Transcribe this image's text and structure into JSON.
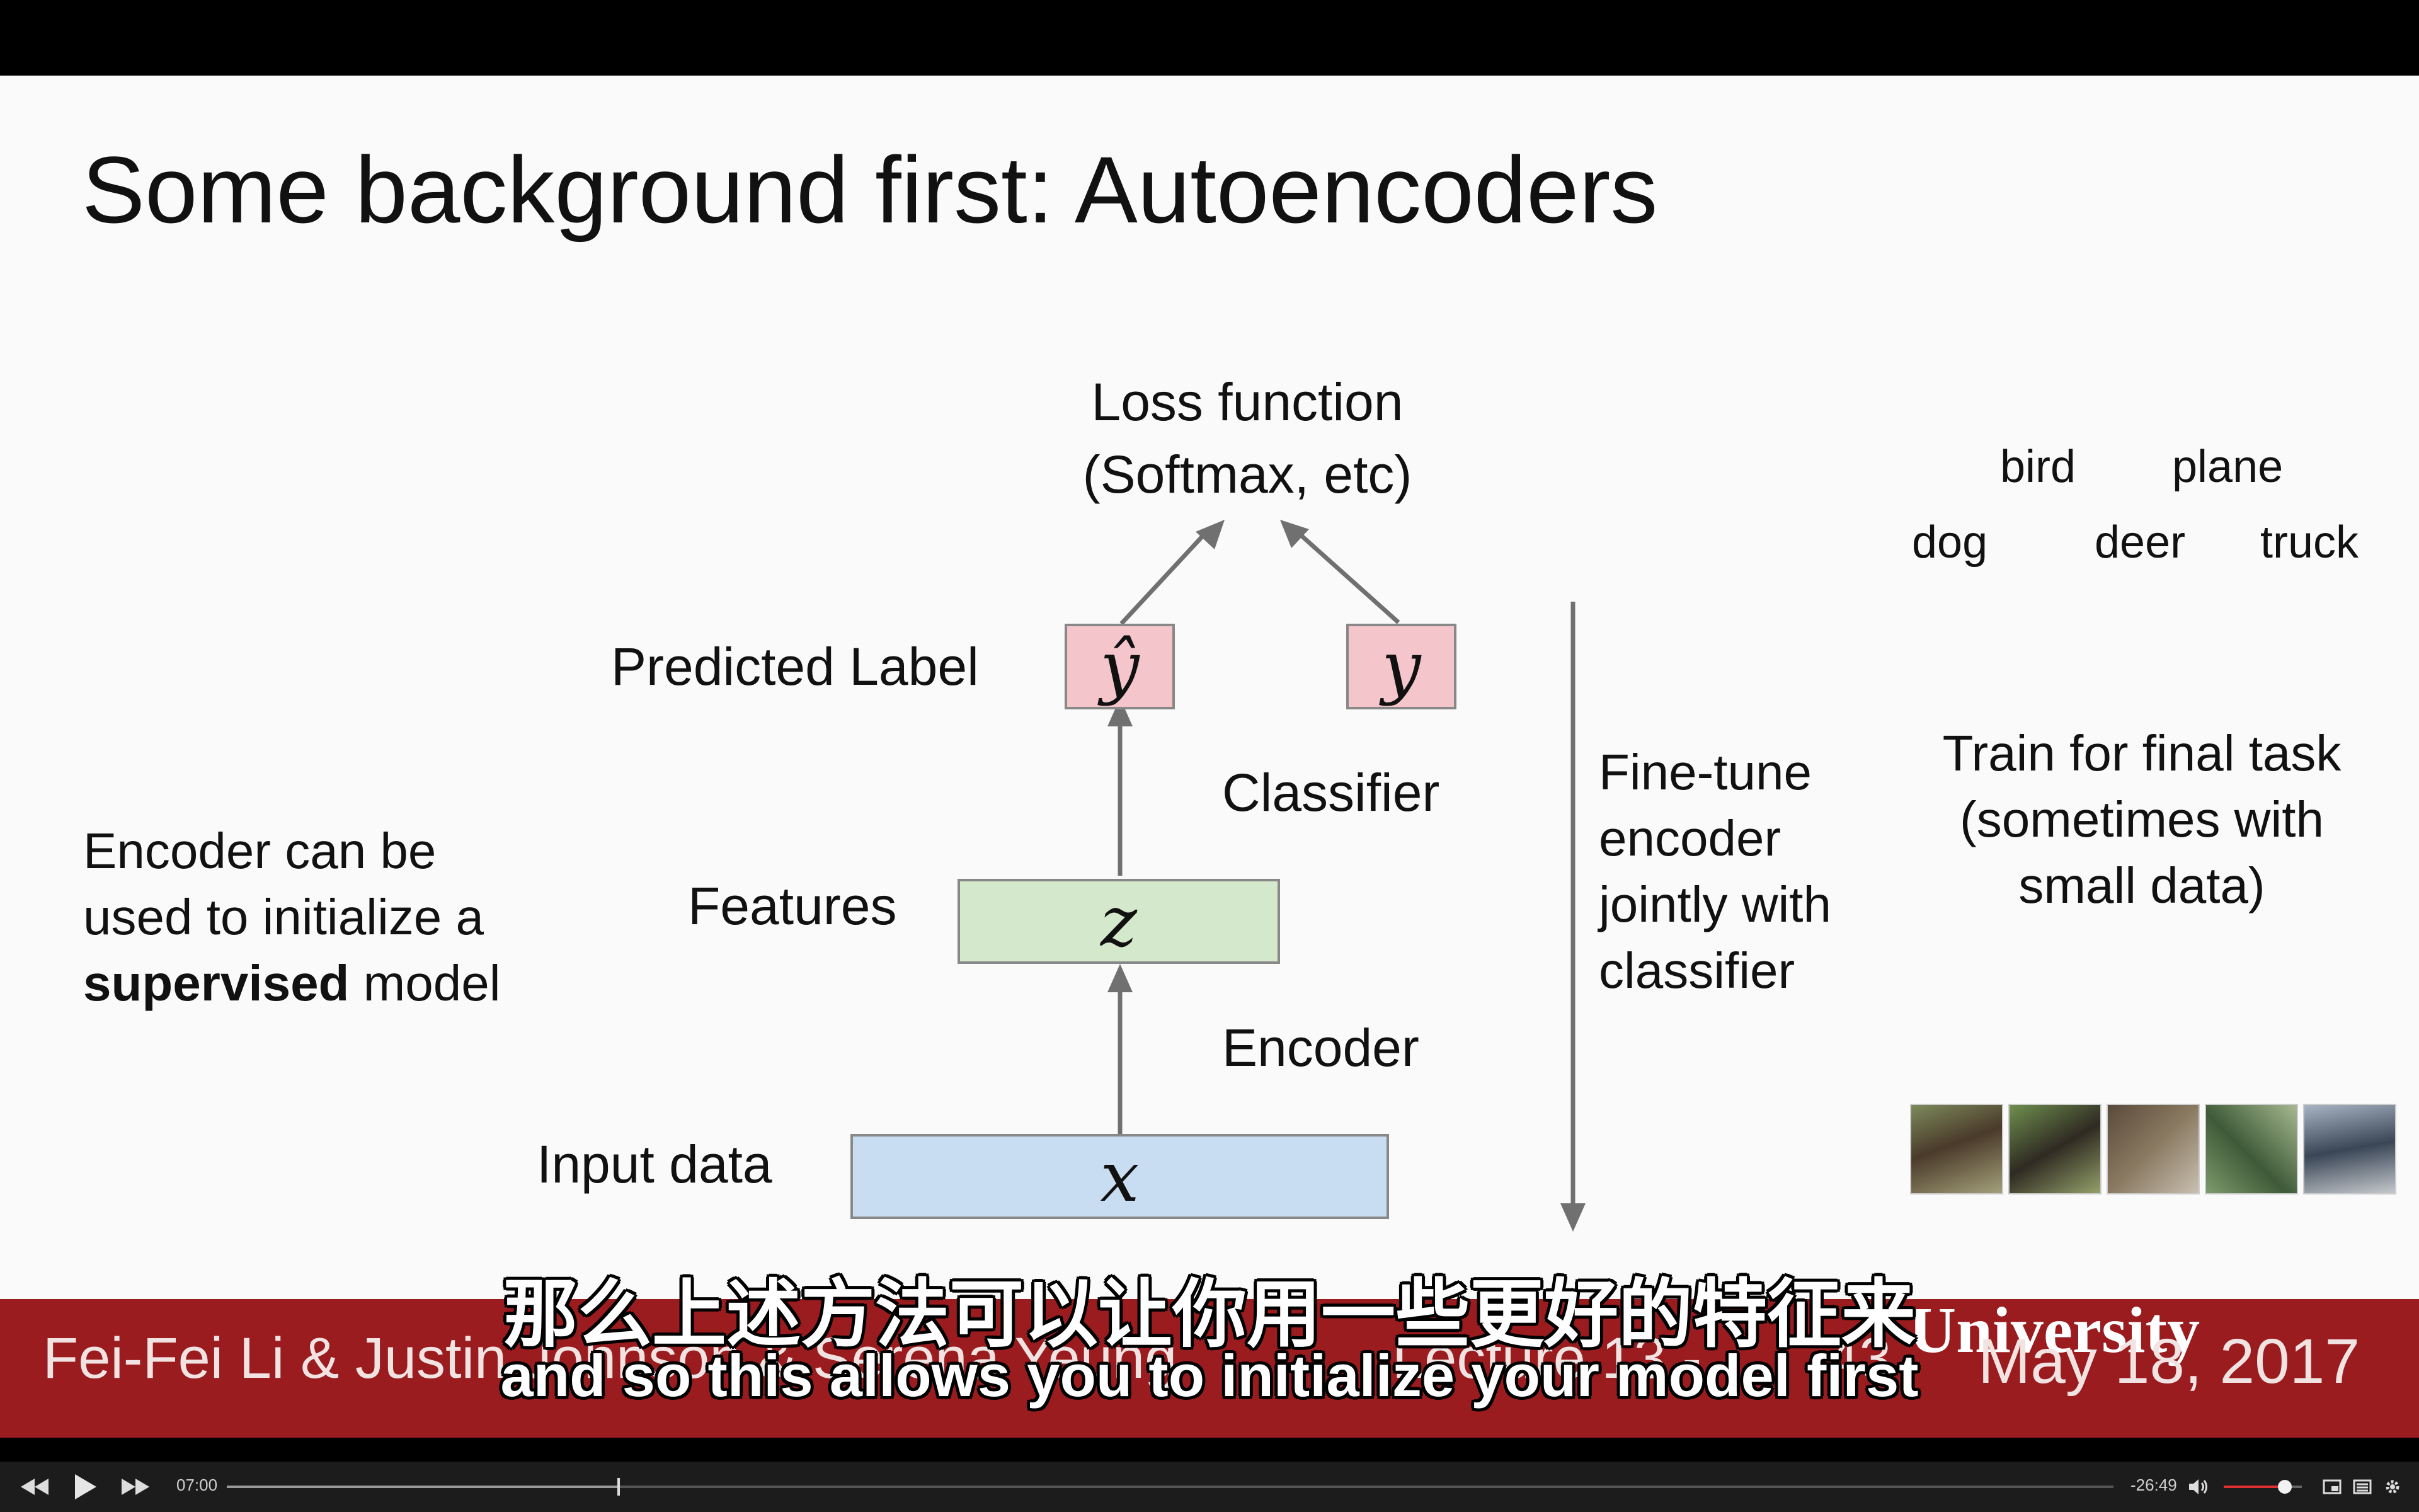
{
  "slide": {
    "title": "Some background first: Autoencoders",
    "loss_line1": "Loss function",
    "loss_line2": "(Softmax, etc)",
    "predicted_label": "Predicted Label",
    "y_hat": "ŷ",
    "y": "y",
    "classifier": "Classifier",
    "features": "Features",
    "z": "z",
    "encoder": "Encoder",
    "input_data": "Input data",
    "x": "x",
    "left_note_line1": "Encoder can be",
    "left_note_line2": "used to initialize a",
    "left_note_bold": "supervised",
    "left_note_rest": " model",
    "finetune_lines": [
      "Fine-tune",
      "encoder",
      "jointly with",
      "classifier"
    ],
    "class_labels": [
      "bird",
      "plane",
      "dog",
      "deer",
      "truck"
    ],
    "train_lines": [
      "Train for final task",
      "(sometimes with",
      "small data)"
    ]
  },
  "footer": {
    "authors": "Fei-Fei Li & Justin Johnson & Serena Yeung",
    "lecture": "Lecture 13 -",
    "page": "43",
    "university": "University",
    "date": "May 18, 2017"
  },
  "subtitles": {
    "zh": "那么上述方法可以让你用一些更好的特征来",
    "en": "and so this allows you to initialize your model first"
  },
  "player": {
    "elapsed": "07:00",
    "remaining": "-26:49",
    "progress": 0.207,
    "volume": 0.78,
    "icons": [
      "rewind-icon",
      "play-icon",
      "fast-forward-icon",
      "volume-icon",
      "picture-in-picture-icon",
      "chapters-icon",
      "settings-icon"
    ]
  }
}
